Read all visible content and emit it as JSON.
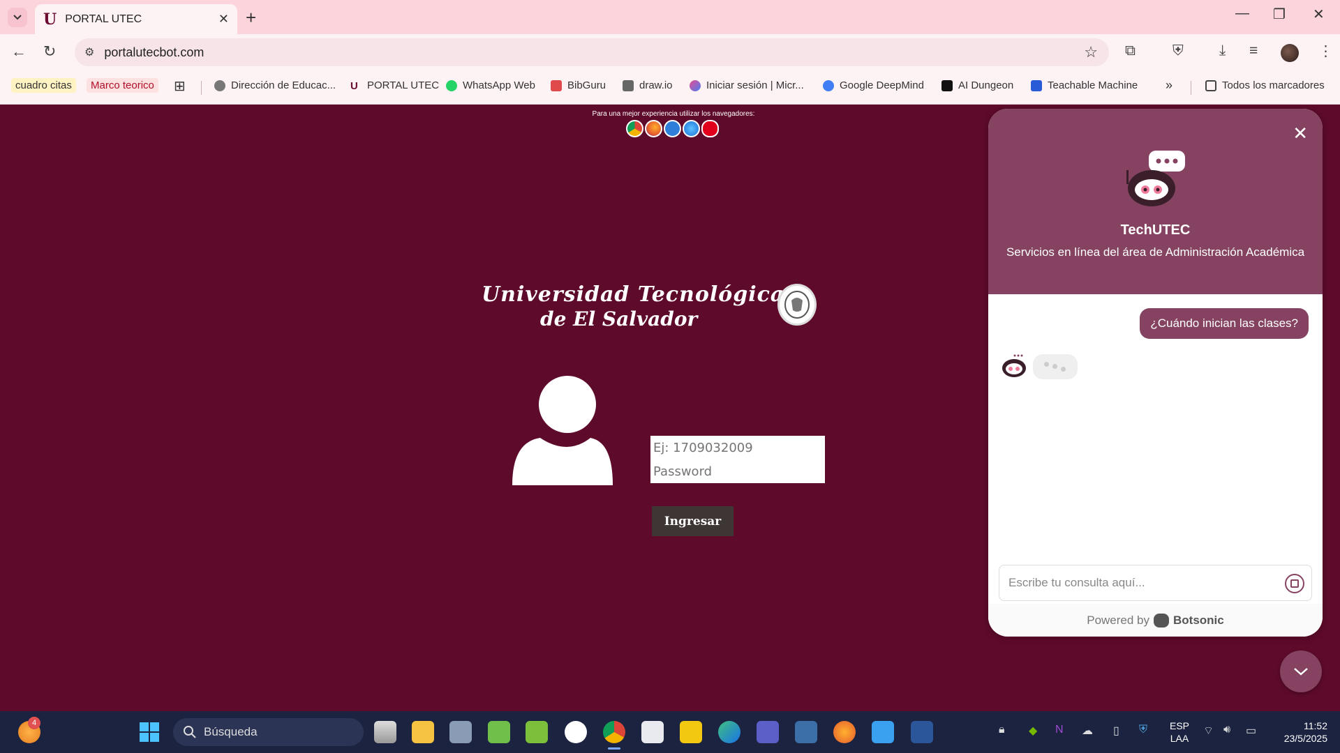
{
  "tab": {
    "title": "PORTAL UTEC",
    "favicon": "U"
  },
  "omnibox": {
    "url": "portalutecbot.com"
  },
  "bookmarks": [
    {
      "label": "cuadro citas",
      "color": "#fff3c4"
    },
    {
      "label": "Marco teorico",
      "color": "#fde0e0"
    },
    {
      "label": "Dirección de Educac..."
    },
    {
      "label": "PORTAL UTEC"
    },
    {
      "label": "WhatsApp Web"
    },
    {
      "label": "BibGuru"
    },
    {
      "label": "draw.io"
    },
    {
      "label": "Iniciar sesión | Micr..."
    },
    {
      "label": "Google DeepMind"
    },
    {
      "label": "AI Dungeon"
    },
    {
      "label": "Teachable Machine"
    },
    {
      "label": "Todos los marcadores"
    }
  ],
  "page": {
    "browser_note": "Para una mejor experiencia utilizar los navegadores:",
    "uni_line1": "Universidad Tecnológica",
    "uni_line2": "de El Salvador",
    "user_placeholder": "Ej: 1709032009",
    "password_placeholder": "Password",
    "login_label": "Ingresar"
  },
  "chat": {
    "title": "TechUTEC",
    "subtitle": "Servicios en línea del área de Administración Académica",
    "user_message": "¿Cuándo inician las clases?",
    "input_placeholder": "Escribe tu consulta aquí...",
    "powered_by": "Powered by",
    "brand": "Botsonic",
    "accent": "#854361"
  },
  "taskbar": {
    "search_placeholder": "Búsqueda",
    "notification_count": "4",
    "lang_top": "ESP",
    "lang_bottom": "LAA",
    "time": "11:52",
    "date": "23/5/2025"
  }
}
